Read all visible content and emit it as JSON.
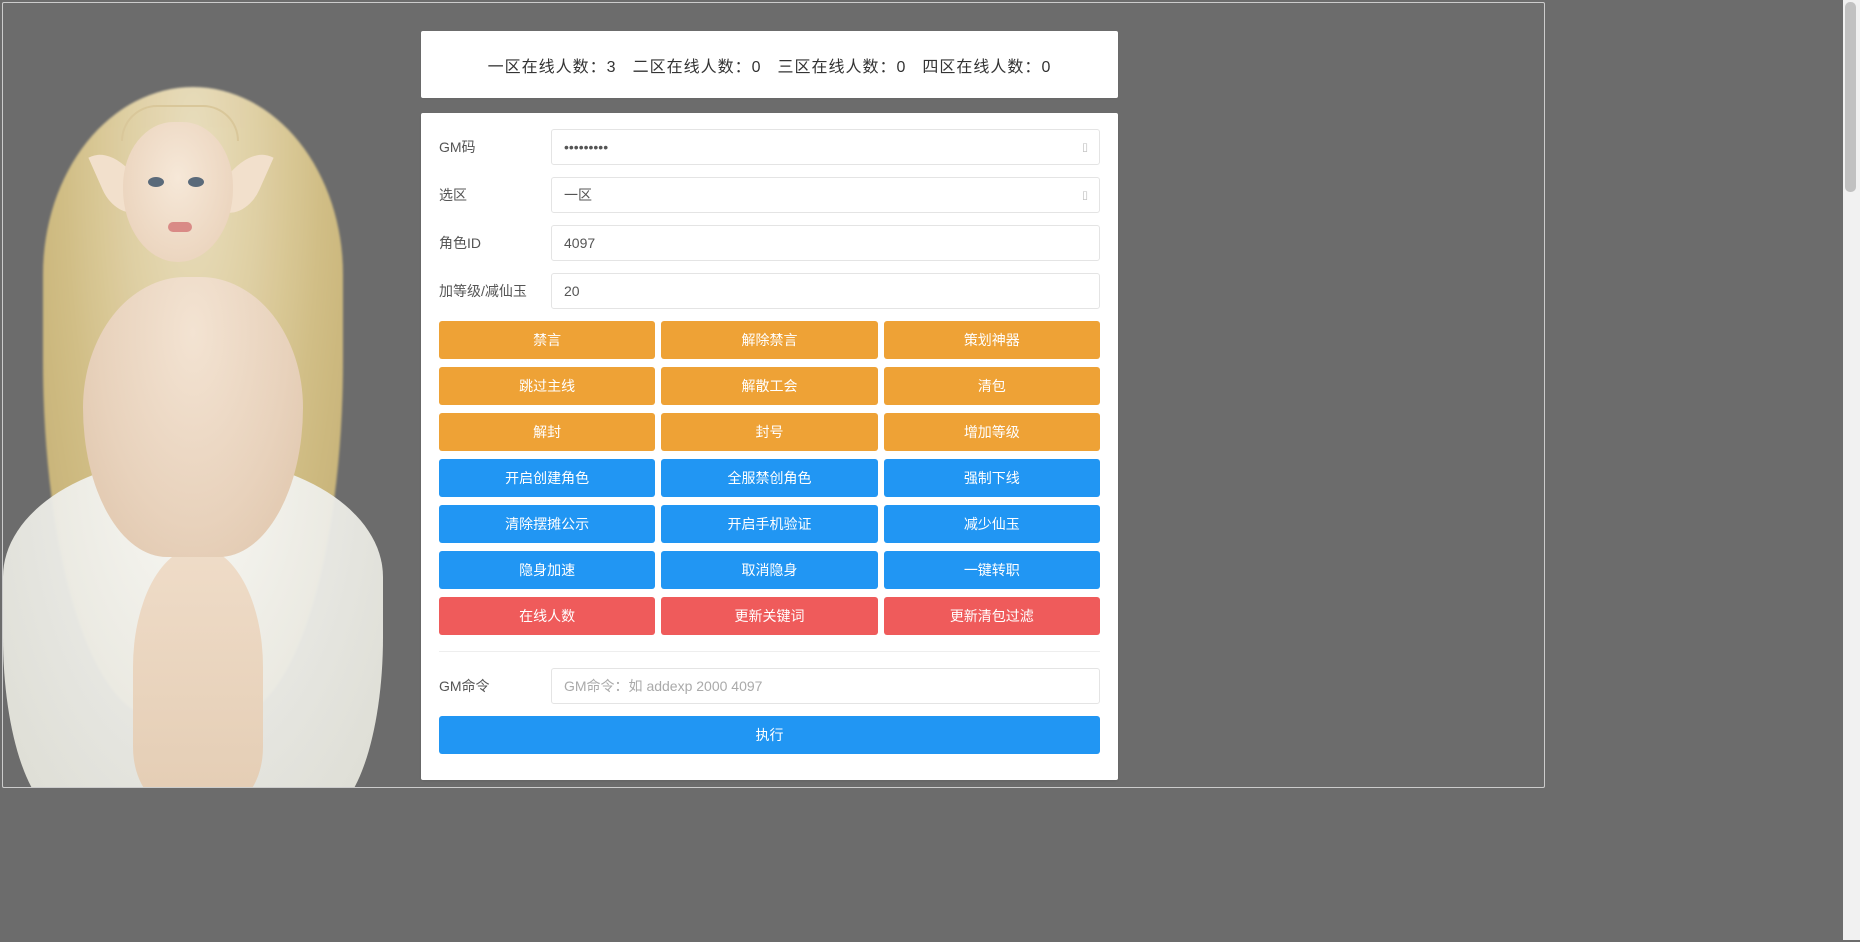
{
  "header": {
    "stats": [
      {
        "label": "一区在线人数：",
        "value": "3"
      },
      {
        "label": "二区在线人数：",
        "value": "0"
      },
      {
        "label": "三区在线人数：",
        "value": "0"
      },
      {
        "label": "四区在线人数：",
        "value": "0"
      }
    ]
  },
  "form": {
    "gm_code_label": "GM码",
    "gm_code_value": "•••••••••",
    "zone_label": "选区",
    "zone_value": "一区",
    "role_id_label": "角色ID",
    "role_id_value": "4097",
    "level_label": "加等级/减仙玉",
    "level_value": "20"
  },
  "button_rows": [
    {
      "color": "warning",
      "items": [
        "禁言",
        "解除禁言",
        "策划神器"
      ]
    },
    {
      "color": "warning",
      "items": [
        "跳过主线",
        "解散工会",
        "清包"
      ]
    },
    {
      "color": "warning",
      "items": [
        "解封",
        "封号",
        "增加等级"
      ]
    },
    {
      "color": "primary",
      "items": [
        "开启创建角色",
        "全服禁创角色",
        "强制下线"
      ]
    },
    {
      "color": "primary",
      "items": [
        "清除摆摊公示",
        "开启手机验证",
        "减少仙玉"
      ]
    },
    {
      "color": "primary",
      "items": [
        "隐身加速",
        "取消隐身",
        "一键转职"
      ]
    },
    {
      "color": "danger",
      "items": [
        "在线人数",
        "更新关键词",
        "更新清包过滤"
      ]
    }
  ],
  "cmd": {
    "label": "GM命令",
    "placeholder": "GM命令：如 addexp 2000 4097",
    "submit": "执行"
  }
}
